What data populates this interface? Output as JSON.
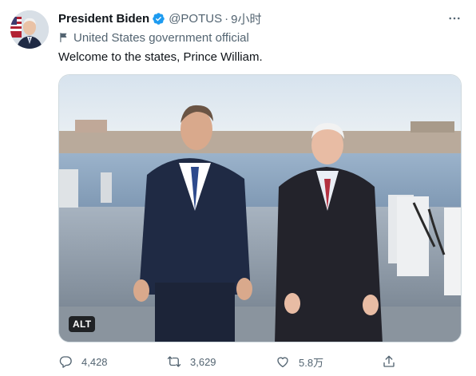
{
  "tweet": {
    "author_name": "President Biden",
    "handle": "@POTUS",
    "separator": "·",
    "time": "9小时",
    "label": "United States government official",
    "text": "Welcome to the states, Prince William.",
    "media_alt_badge": "ALT"
  },
  "actions": {
    "replies": "4,428",
    "retweets": "3,629",
    "likes": "5.8万"
  },
  "icons": {
    "verified": "verified-badge-icon",
    "more": "more-horizontal-icon",
    "flag": "flag-icon",
    "reply": "reply-icon",
    "retweet": "retweet-icon",
    "like": "heart-icon",
    "share": "share-icon"
  },
  "colors": {
    "verified_blue": "#1d9bf0",
    "secondary_text": "#536471",
    "primary_text": "#0f1419"
  }
}
